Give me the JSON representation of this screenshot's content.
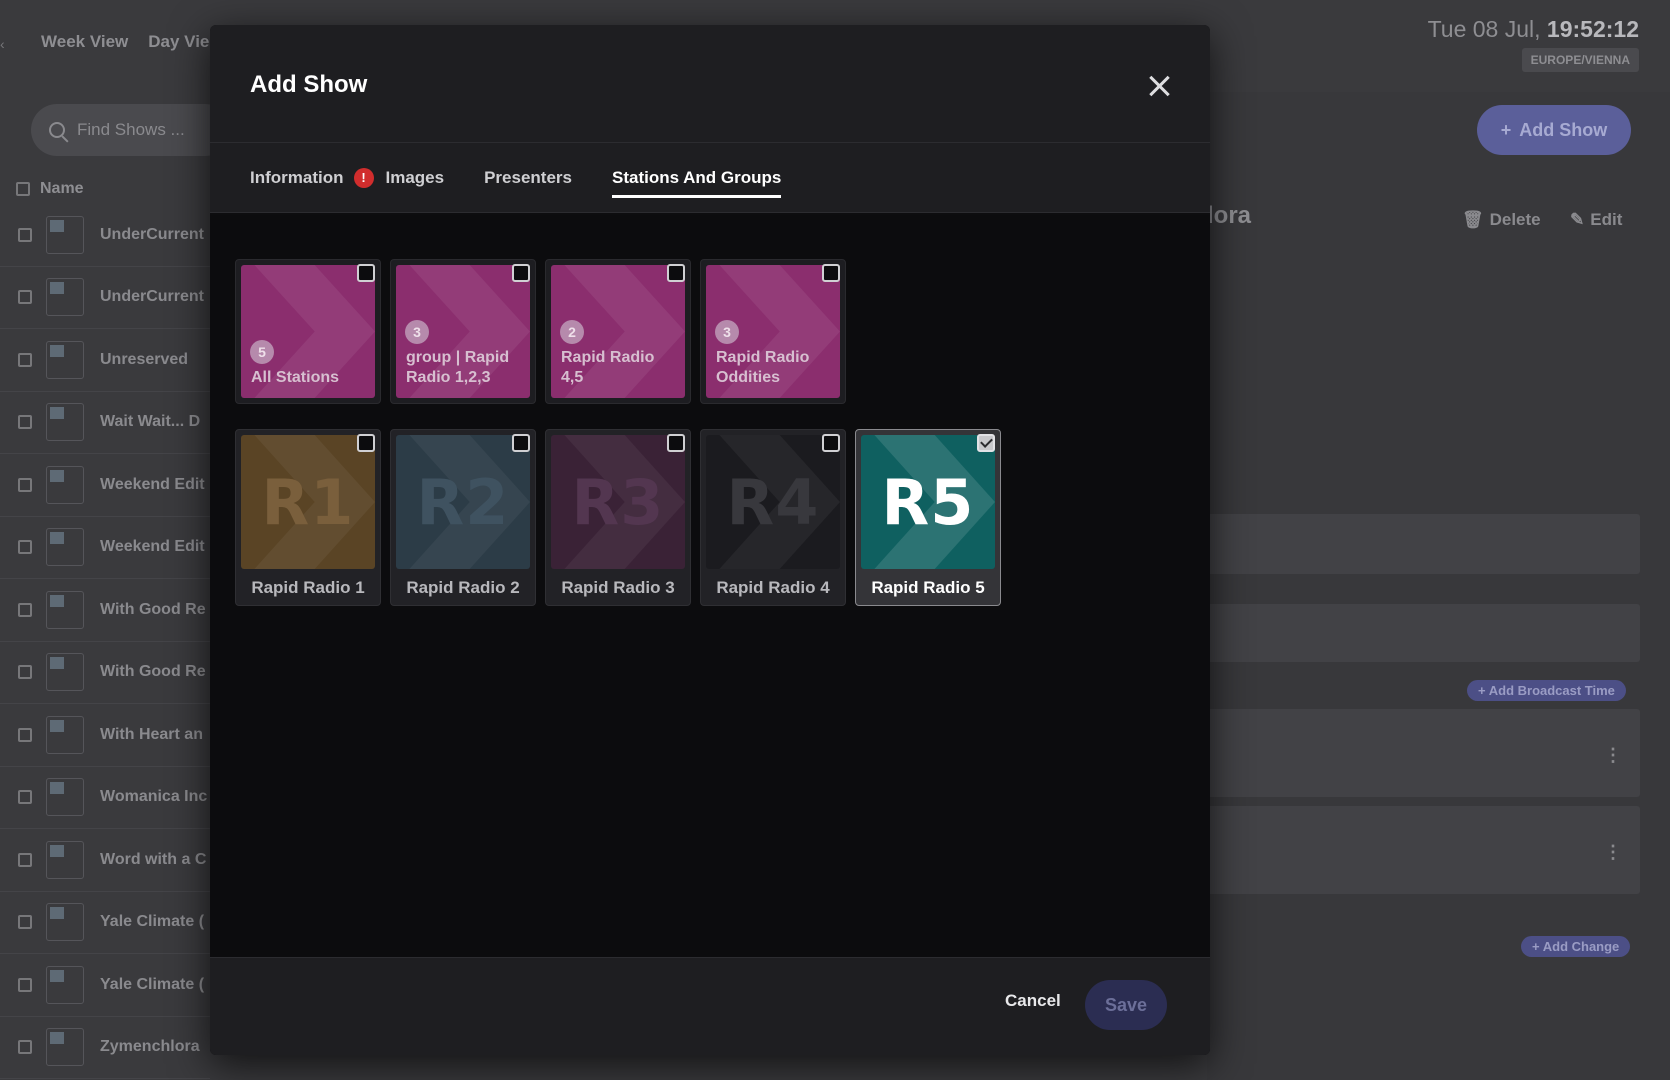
{
  "background": {
    "nav": [
      "Week View",
      "Day Vie"
    ],
    "left_edge_glyph": "‹",
    "search_placeholder": "Find Shows ...",
    "list_header": "Name",
    "rows": [
      "UnderCurrent",
      "UnderCurrent",
      "Unreserved",
      "Wait Wait... D",
      "Weekend Edit",
      "Weekend Edit",
      "With Good Re",
      "With Good Re",
      "With Heart an",
      "Womanica Inc",
      "Word with a C",
      "Yale Climate (",
      "Yale Climate (",
      "Zymenchlora"
    ],
    "clock_prefix": "Tue 08 Jul, ",
    "clock_time": "19:52:12",
    "timezone": "EUROPE/VIENNA",
    "add_show": "Add Show",
    "title_fragment": "lora",
    "delete_label": "Delete",
    "edit_label": "Edit",
    "add_broadcast_time": "Add Broadcast Time",
    "add_change": "Add Change"
  },
  "modal": {
    "title": "Add Show",
    "tabs": [
      {
        "label": "Information",
        "has_error": true,
        "error_glyph": "!"
      },
      {
        "label": "Images"
      },
      {
        "label": "Presenters"
      },
      {
        "label": "Stations And Groups",
        "active": true
      }
    ],
    "groups": [
      {
        "count": "5",
        "label": "All Stations",
        "checked": false
      },
      {
        "count": "3",
        "label": "group | Rapid Radio 1,2,3",
        "checked": false
      },
      {
        "count": "2",
        "label": "Rapid Radio 4,5",
        "checked": false
      },
      {
        "count": "3",
        "label": "Rapid Radio Oddities",
        "checked": false
      }
    ],
    "stations": [
      {
        "code": "R1",
        "name": "Rapid Radio 1",
        "bg": "#5a4425",
        "fg": "#7a5f3c",
        "checked": false
      },
      {
        "code": "R2",
        "name": "Rapid Radio 2",
        "bg": "#2c3c47",
        "fg": "#3f5260",
        "checked": false
      },
      {
        "code": "R3",
        "name": "Rapid Radio 3",
        "bg": "#3a2236",
        "fg": "#533650",
        "checked": false
      },
      {
        "code": "R4",
        "name": "Rapid Radio 4",
        "bg": "#1b1b1f",
        "fg": "#38383d",
        "checked": false
      },
      {
        "code": "R5",
        "name": "Rapid Radio 5",
        "bg": "#0f6060",
        "fg": "#ffffff",
        "checked": true
      }
    ],
    "cancel_label": "Cancel",
    "save_label": "Save"
  },
  "colors": {
    "group_bg": "#8b2e6e",
    "accent": "#5b5f9a",
    "error": "#d12d2d"
  }
}
